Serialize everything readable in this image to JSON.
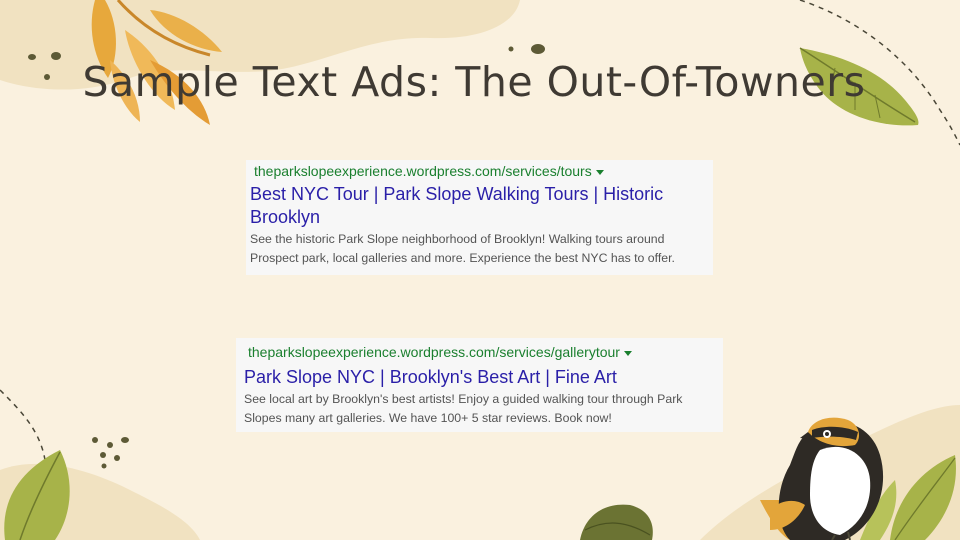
{
  "slide": {
    "title": "Sample Text Ads: The Out-Of-Towners"
  },
  "ads": [
    {
      "url": "theparkslopeexperience.wordpress.com/services/tours",
      "headline": "Best NYC Tour | Park Slope Walking Tours | Historic Brooklyn",
      "description": "See the historic Park Slope neighborhood of Brooklyn! Walking tours around Prospect park, local galleries and more. Experience the best NYC has to offer."
    },
    {
      "url": "theparkslopeexperience.wordpress.com/services/gallerytour",
      "headline": "Park Slope NYC | Brooklyn's Best Art | Fine Art",
      "description": "See local art by Brooklyn's best artists! Enjoy a guided walking tour through Park Slopes many art galleries. We have 100+ 5 star reviews. Book now!"
    }
  ],
  "colors": {
    "background": "#faf1df",
    "blob": "#f1e2c1",
    "ad_url": "#1a7f2e",
    "ad_headline": "#2a1fa8",
    "ad_description": "#545454",
    "title": "#3f3a33"
  },
  "decorations": {
    "icons": [
      "orange-leaves-icon",
      "green-leaf-icon",
      "bird-icon",
      "dashed-path-icon"
    ]
  }
}
